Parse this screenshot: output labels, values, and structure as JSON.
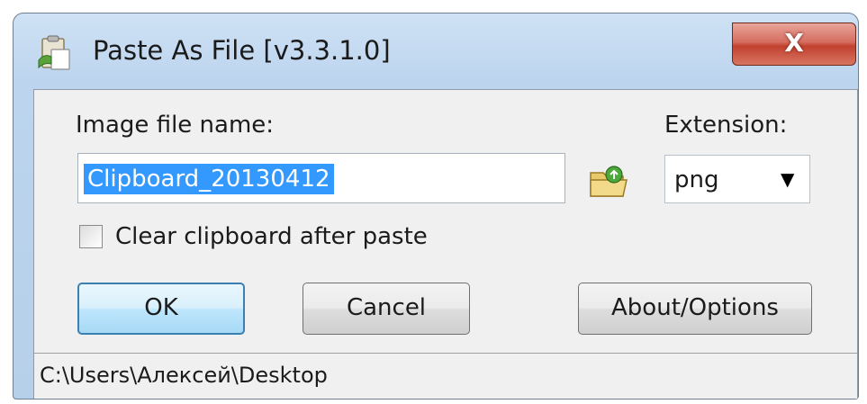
{
  "window": {
    "title": "Paste As File [v3.3.1.0]",
    "close_label": "X",
    "app_icon": "paste-as-file-app-icon"
  },
  "form": {
    "filename_label": "Image file name:",
    "filename_value": "Clipboard_20130412",
    "extension_label": "Extension:",
    "extension_value": "png",
    "browse_icon": "folder-icon",
    "checkbox_label": "Clear clipboard after paste",
    "checkbox_checked": false
  },
  "buttons": {
    "ok_label": "OK",
    "cancel_label": "Cancel",
    "about_label": "About/Options"
  },
  "status": {
    "path": "C:\\Users\\Алексей\\Desktop"
  }
}
